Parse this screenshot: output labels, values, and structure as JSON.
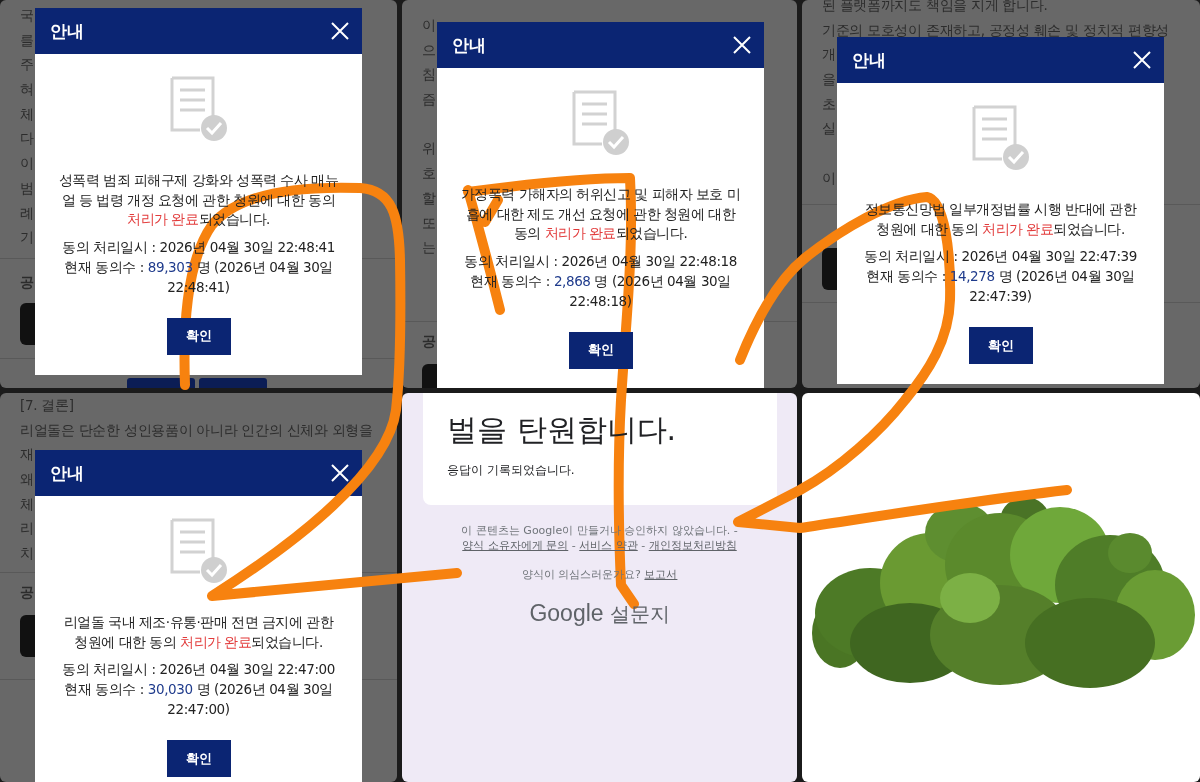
{
  "panels": [
    {
      "kind": "petition_dialog",
      "page": {
        "paragraphs": [
          [
            "국",
            "를",
            "주",
            "혀",
            "체",
            "다",
            "이",
            "범",
            "례",
            "기"
          ]
        ],
        "section_heading": "공"
      },
      "dialog": {
        "title": "안내",
        "message": {
          "before": "성폭력 범죄 피해구제 강화와 성폭력 수사 매뉴얼 등 법령 개정 요청에 관한 청원에 대한 동의 ",
          "highlight": "처리가 완료",
          "after": "되었습니다."
        },
        "processed": "동의 처리일시 : 2026년 04월 30일 22:48:41",
        "count": {
          "label": "현재 동의수 : ",
          "value": "89,303",
          "rest": " 명 (2026년 04월 30일 22:48:41)"
        },
        "button": "확인"
      }
    },
    {
      "kind": "petition_dialog",
      "page": {
        "paragraphs": [
          [
            "이",
            "으",
            "침",
            "즘"
          ],
          [
            "위",
            "호",
            "할",
            "또",
            "는"
          ]
        ],
        "section_heading": "공"
      },
      "dialog": {
        "title": "안내",
        "message": {
          "before": "가정폭력 가해자의 허위신고 및 피해자 보호 미흡에 대한 제도 개선 요청에 관한 청원에 대한 동의 ",
          "highlight": "처리가 완료",
          "after": "되었습니다."
        },
        "processed": "동의 처리일시 : 2026년 04월 30일 22:48:18",
        "count": {
          "label": "현재 동의수 : ",
          "value": "2,868",
          "rest": " 명 (2026년 04월 30일 22:48:18)"
        },
        "button": "확인"
      }
    },
    {
      "kind": "petition_dialog",
      "page": {
        "paragraphs": [
          [
            "된 플랫폼까지도 책임을 지게 합니다.",
            "기준의 모호성이 존재하고, 공정성 훼손 및 정치적 편향성",
            "개",
            "을",
            "초",
            "실"
          ],
          [
            "이"
          ]
        ]
      },
      "dialog": {
        "title": "안내",
        "message": {
          "before": "정보통신망법 일부개정법률 시행 반대에 관한 청원에 대한 동의 ",
          "highlight": "처리가 완료",
          "after": "되었습니다."
        },
        "processed": "동의 처리일시 : 2026년 04월 30일 22:47:39",
        "count": {
          "label": "현재 동의수 : ",
          "value": "14,278",
          "rest": " 명 (2026년 04월 30일 22:47:39)"
        },
        "button": "확인"
      }
    },
    {
      "kind": "petition_dialog",
      "page": {
        "paragraphs": [
          [
            "[7. 결론]",
            "리얼돌은 단순한 성인용품이 아니라 인간의 신체와 외형을",
            "재",
            "왜",
            "체",
            "리",
            "치"
          ]
        ],
        "section_heading": "공"
      },
      "dialog": {
        "title": "안내",
        "message": {
          "before": "리얼돌 국내 제조·유통·판매 전면 금지에 관한 청원에 대한 동의 ",
          "highlight": "처리가 완료",
          "after": "되었습니다."
        },
        "processed": "동의 처리일시 : 2026년 04월 30일 22:47:00",
        "count": {
          "label": "현재 동의수 : ",
          "value": "30,030",
          "rest": " 명 (2026년 04월 30일 22:47:00)"
        },
        "button": "확인"
      }
    },
    {
      "kind": "form_confirmation",
      "heading": "벌을 탄원합니다.",
      "status": "응답이 기록되었습니다.",
      "footer": {
        "notice": "이 콘텐츠는 Google이 만들거나 승인하지 않았습니다.",
        "separator": "-",
        "links": [
          "양식 소유자에게 문의",
          "서비스 약관",
          "개인정보처리방침"
        ],
        "question": "양식이 의심스러운가요?",
        "report_link": "보고서"
      },
      "logo": {
        "brand": "Google",
        "product": "설문지"
      }
    },
    {
      "kind": "photo"
    }
  ]
}
